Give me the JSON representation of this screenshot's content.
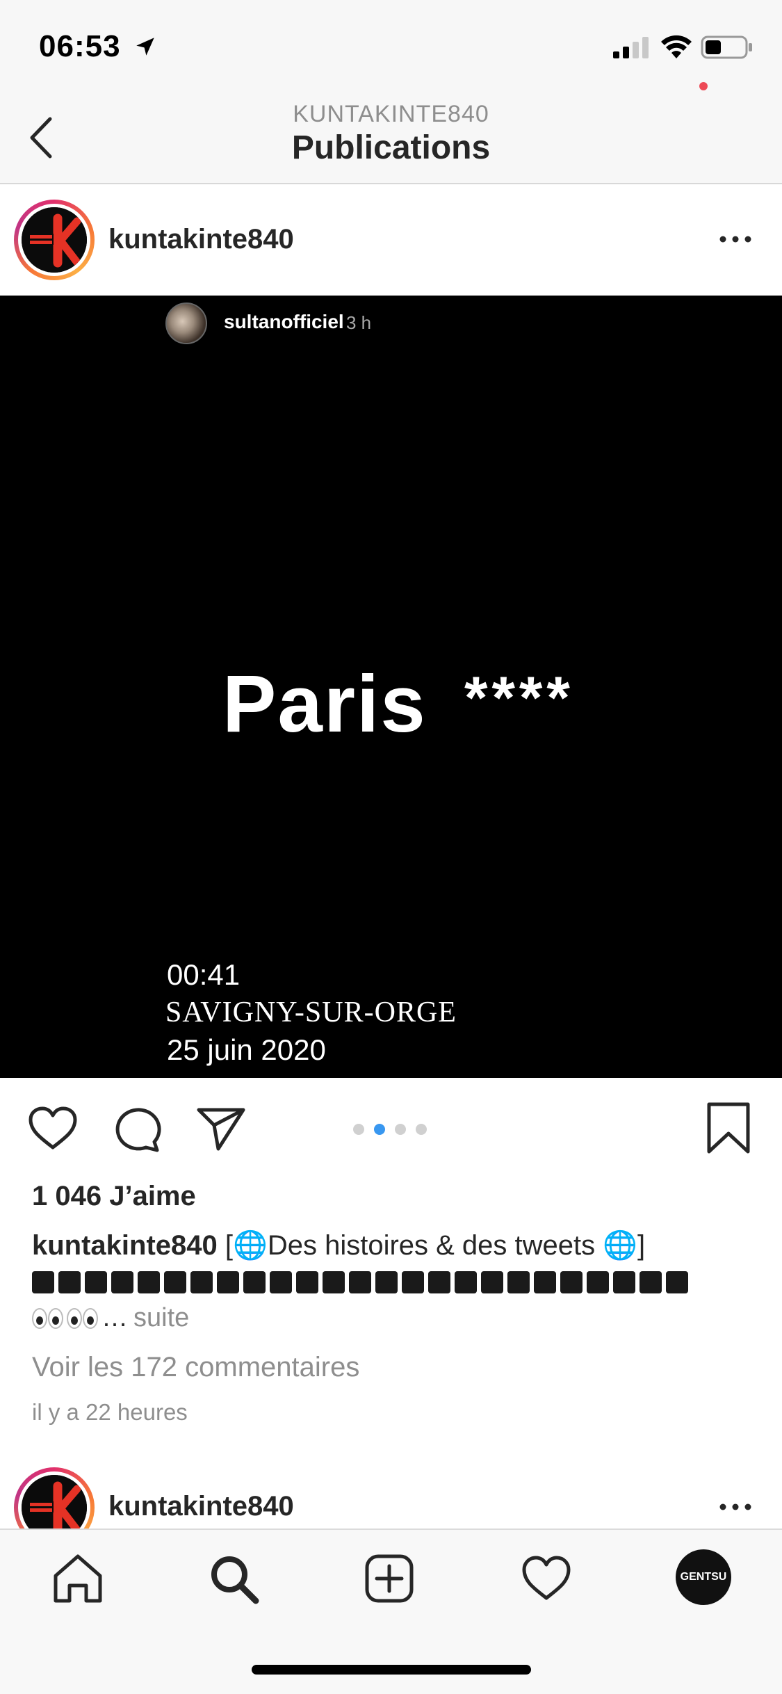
{
  "status_bar": {
    "time": "06:53"
  },
  "header": {
    "subtitle": "KUNTAKINTE840",
    "title": "Publications"
  },
  "post": {
    "username": "kuntakinte840",
    "story": {
      "username": "sultanofficiel",
      "age": "3 h",
      "text": "Paris",
      "stars": "****",
      "time": "00:41",
      "place": "SAVIGNY-SUR-ORGE",
      "date": "25 juin 2020"
    },
    "carousel": {
      "count": 4,
      "active_index": 1
    },
    "likes": "1 046 J’aime",
    "caption_user": "kuntakinte840",
    "caption_text": "[🌐Des histoires & des tweets 🌐]",
    "more_label": "suite",
    "comments_link": "Voir les 172 commentaires",
    "time_ago": "il y a 22 heures"
  },
  "next_post": {
    "username": "kuntakinte840"
  },
  "tabbar": {
    "profile_label": "GENTSU"
  },
  "colors": {
    "accent": "#3897f0",
    "notification": "#ed4956"
  }
}
